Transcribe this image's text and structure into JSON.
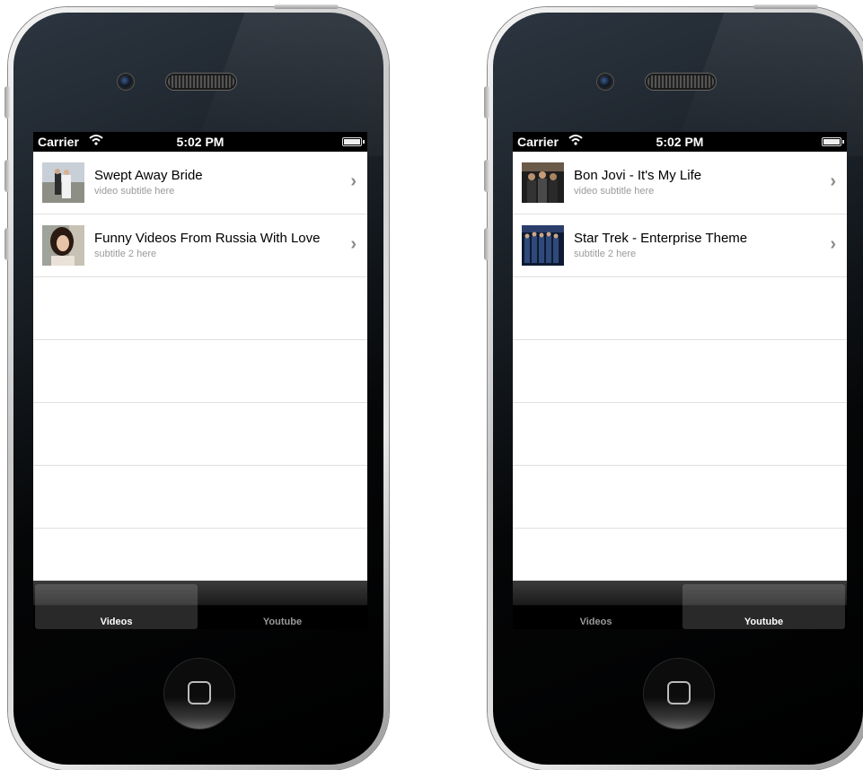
{
  "phones": [
    {
      "statusbar": {
        "carrier": "Carrier",
        "time": "5:02 PM"
      },
      "rows": [
        {
          "title": "Swept Away Bride",
          "subtitle": "video subtitle here",
          "thumb": "wedding-thumb"
        },
        {
          "title": "Funny Videos From Russia With Love",
          "subtitle": "subtitle 2 here",
          "thumb": "portrait-thumb"
        }
      ],
      "tabs": [
        {
          "label": "Videos",
          "selected": true
        },
        {
          "label": "Youtube",
          "selected": false
        }
      ]
    },
    {
      "statusbar": {
        "carrier": "Carrier",
        "time": "5:02 PM"
      },
      "rows": [
        {
          "title": "Bon Jovi - It's My Life",
          "subtitle": "video subtitle here",
          "thumb": "band-thumb"
        },
        {
          "title": "Star Trek - Enterprise Theme",
          "subtitle": "subtitle 2 here",
          "thumb": "crew-thumb"
        }
      ],
      "tabs": [
        {
          "label": "Videos",
          "selected": false
        },
        {
          "label": "Youtube",
          "selected": true
        }
      ]
    }
  ],
  "icons": {
    "wifi": "wifi-icon",
    "battery": "battery-icon",
    "chevron": "chevron-right-icon",
    "home": "home-button"
  }
}
